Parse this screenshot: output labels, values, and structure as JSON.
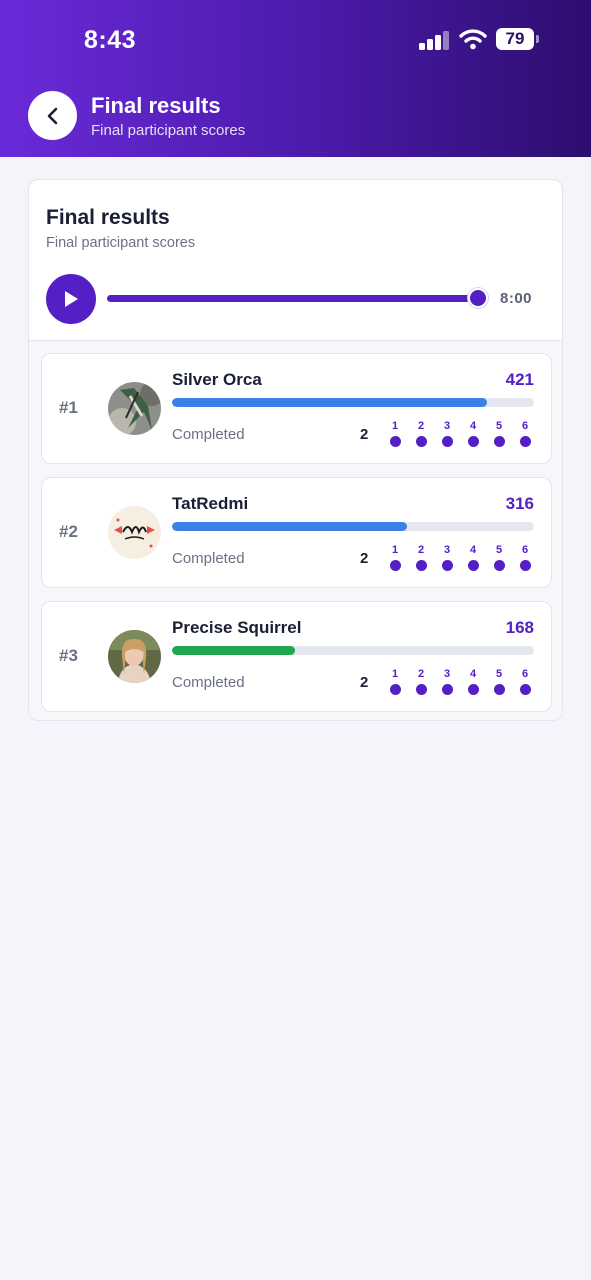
{
  "status_bar": {
    "time": "8:43",
    "battery": "79"
  },
  "header": {
    "title": "Final results",
    "subtitle": "Final participant scores"
  },
  "card": {
    "title": "Final results",
    "subtitle": "Final participant scores",
    "playback": {
      "time": "8:00",
      "progress_percent": 100
    }
  },
  "participants": [
    {
      "rank": "#1",
      "name": "Silver Orca",
      "score": "421",
      "status": "Completed",
      "count": "2",
      "bar_percent": 87,
      "bar_color": "#3b82e6",
      "steps": [
        "1",
        "2",
        "3",
        "4",
        "5",
        "6"
      ]
    },
    {
      "rank": "#2",
      "name": "TatRedmi",
      "score": "316",
      "status": "Completed",
      "count": "2",
      "bar_percent": 65,
      "bar_color": "#3b82e6",
      "steps": [
        "1",
        "2",
        "3",
        "4",
        "5",
        "6"
      ]
    },
    {
      "rank": "#3",
      "name": "Precise Squirrel",
      "score": "168",
      "status": "Completed",
      "count": "2",
      "bar_percent": 34,
      "bar_color": "#1fa64f",
      "steps": [
        "1",
        "2",
        "3",
        "4",
        "5",
        "6"
      ]
    }
  ],
  "colors": {
    "accent": "#5420c6",
    "header_start": "#6a2ad9",
    "header_end": "#2c0e6e"
  }
}
